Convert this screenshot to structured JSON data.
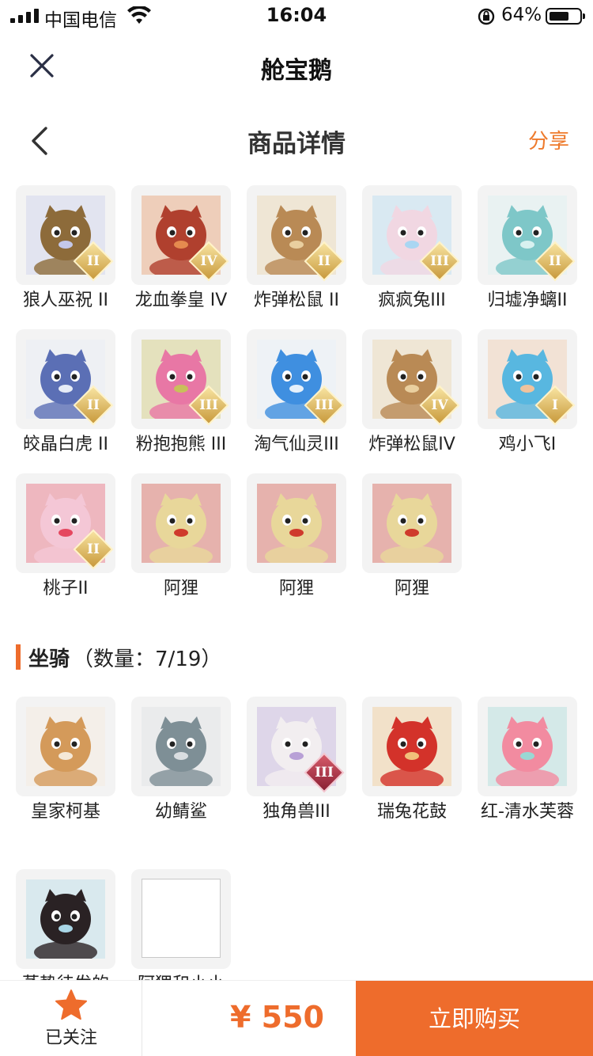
{
  "status_bar": {
    "carrier": "中国电信",
    "time": "16:04",
    "battery": "64%"
  },
  "app": {
    "title": "舱宝鹅"
  },
  "page": {
    "title": "商品详情",
    "share_label": "分享"
  },
  "characters": [
    {
      "name": "狼人巫祝 II",
      "badge": "II",
      "color": "#8d6b3a",
      "accent": "#c4c8ea"
    },
    {
      "name": "龙血拳皇 IV",
      "badge": "IV",
      "color": "#b0402e",
      "accent": "#e58a4f"
    },
    {
      "name": "炸弹松鼠 II",
      "badge": "II",
      "color": "#b98a55",
      "accent": "#e9cf9f"
    },
    {
      "name": "疯疯兔III",
      "badge": "III",
      "color": "#f1d7e2",
      "accent": "#a9d6f2"
    },
    {
      "name": "归墟净螭II",
      "badge": "II",
      "color": "#7ec7c8",
      "accent": "#d8f1f0"
    },
    {
      "name": "皎晶白虎 II",
      "badge": "II",
      "color": "#5b6fb5",
      "accent": "#e6ecf7"
    },
    {
      "name": "粉抱抱熊 III",
      "badge": "III",
      "color": "#e877a5",
      "accent": "#c8c05a"
    },
    {
      "name": "淘气仙灵III",
      "badge": "III",
      "color": "#3f8fe0",
      "accent": "#e6f1fb"
    },
    {
      "name": "炸弹松鼠IV",
      "badge": "IV",
      "color": "#b98a55",
      "accent": "#e9cf9f"
    },
    {
      "name": "鸡小飞I",
      "badge": "I",
      "color": "#58b7e0",
      "accent": "#f0c39d"
    },
    {
      "name": "桃子II",
      "badge": "II",
      "color": "#f4c7d6",
      "accent": "#e5475f"
    },
    {
      "name": "阿狸",
      "badge": "",
      "color": "#e8d79a",
      "accent": "#cf3a2c"
    },
    {
      "name": "阿狸",
      "badge": "",
      "color": "#e8d79a",
      "accent": "#cf3a2c"
    },
    {
      "name": "阿狸",
      "badge": "",
      "color": "#e8d79a",
      "accent": "#cf3a2c"
    }
  ],
  "mounts_section": {
    "title": "坐骑",
    "count_text": "（数量：7/19）"
  },
  "mounts": [
    {
      "name": "皇家柯基",
      "badge": "",
      "color": "#d49a5a",
      "accent": "#f5e9d8"
    },
    {
      "name": "幼鲭鲨",
      "badge": "",
      "color": "#7e8f96",
      "accent": "#d9dde0"
    },
    {
      "name": "独角兽III",
      "badge": "III",
      "color": "#f2eef0",
      "accent": "#b8a0d6"
    },
    {
      "name": "瑞兔花鼓",
      "badge": "",
      "color": "#d3322a",
      "accent": "#f1c07a"
    },
    {
      "name": "红-清水芙蓉",
      "badge": "",
      "color": "#f28ba0",
      "accent": "#9ad8d4"
    },
    {
      "name": "蒸势待发的",
      "badge": "",
      "color": "#2a2224",
      "accent": "#a9d6e6"
    },
    {
      "name": "阿狸和小小",
      "badge": "",
      "color": "",
      "accent": ""
    }
  ],
  "bottom_bar": {
    "follow_label": "已关注",
    "price": "¥ 550",
    "buy_label": "立即购买"
  },
  "colors": {
    "accent": "#ee6c2c",
    "share": "#ee7a2c"
  }
}
